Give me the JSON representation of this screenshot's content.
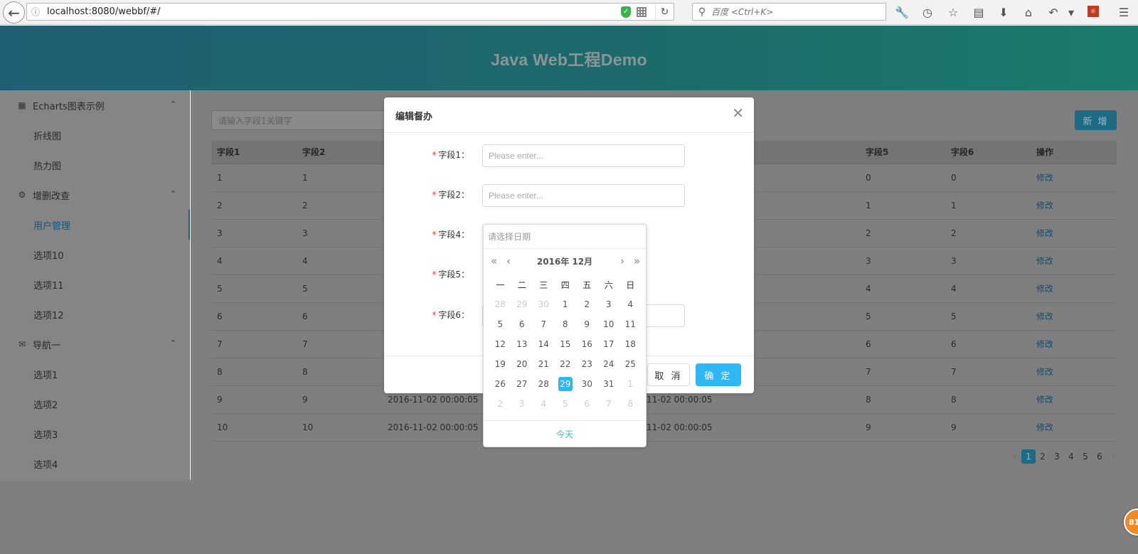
{
  "browser": {
    "url": "localhost:8080/webbf/#/",
    "search_placeholder": "百度 <Ctrl+K>"
  },
  "app": {
    "title": "Java Web工程Demo"
  },
  "sidebar": {
    "groups": [
      {
        "label": "Echarts图表示例",
        "items": [
          "折线图",
          "热力图"
        ]
      },
      {
        "label": "增删改查",
        "items": [
          "用户管理",
          "选项10",
          "选项11",
          "选项12"
        ]
      },
      {
        "label": "导航一",
        "items": [
          "选项1",
          "选项2",
          "选项3",
          "选项4"
        ]
      }
    ],
    "active_item": "用户管理"
  },
  "main": {
    "filter_placeholder": "请输入字段1关键字",
    "new_button": "新 增",
    "columns": [
      "字段1",
      "字段2",
      "",
      "",
      "",
      "",
      "",
      "字段5",
      "字段6",
      "操作"
    ],
    "rows": [
      [
        "1",
        "1",
        "",
        "",
        "0",
        "0",
        "修改"
      ],
      [
        "2",
        "2",
        "",
        "",
        "1",
        "1",
        "修改"
      ],
      [
        "3",
        "3",
        "",
        "",
        "2",
        "2",
        "修改"
      ],
      [
        "4",
        "4",
        "",
        "",
        "3",
        "3",
        "修改"
      ],
      [
        "5",
        "5",
        "",
        "",
        "4",
        "4",
        "修改"
      ],
      [
        "6",
        "6",
        "",
        "",
        "5",
        "5",
        "修改"
      ],
      [
        "7",
        "7",
        "",
        "",
        "6",
        "6",
        "修改"
      ],
      [
        "8",
        "8",
        "",
        "",
        "7",
        "7",
        "修改"
      ],
      [
        "9",
        "9",
        "2016-11-02 00:00:05",
        "6-11-02 00:00:05",
        "8",
        "8",
        "修改"
      ],
      [
        "10",
        "10",
        "2016-11-02 00:00:05",
        "6-11-02 00:00:05",
        "9",
        "9",
        "修改"
      ]
    ],
    "pagination": {
      "pages": [
        "1",
        "2",
        "3",
        "4",
        "5",
        "6"
      ],
      "current": "1",
      "prev": "‹",
      "next": "›"
    }
  },
  "modal": {
    "title": "编辑督办",
    "close": "✕",
    "fields": [
      {
        "label": "字段1",
        "placeholder": "Please enter..."
      },
      {
        "label": "字段2",
        "placeholder": "Please enter..."
      },
      {
        "label": "字段4"
      },
      {
        "label": "字段5"
      },
      {
        "label": "字段6"
      }
    ],
    "required_mark": "*",
    "cancel": "取 消",
    "ok": "确 定"
  },
  "datepicker": {
    "placeholder": "请选择日期",
    "header": "2016年 12月",
    "nav": {
      "prev_year": "«",
      "prev_month": "‹",
      "next_month": "›",
      "next_year": "»"
    },
    "weekdays": [
      "一",
      "二",
      "三",
      "四",
      "五",
      "六",
      "日"
    ],
    "days": [
      [
        "28",
        "m"
      ],
      [
        "29",
        "m"
      ],
      [
        "30",
        "m"
      ],
      [
        "1",
        ""
      ],
      [
        "2",
        ""
      ],
      [
        "3",
        ""
      ],
      [
        "4",
        ""
      ],
      [
        "5",
        ""
      ],
      [
        "6",
        ""
      ],
      [
        "7",
        ""
      ],
      [
        "8",
        ""
      ],
      [
        "9",
        ""
      ],
      [
        "10",
        ""
      ],
      [
        "11",
        ""
      ],
      [
        "12",
        ""
      ],
      [
        "13",
        ""
      ],
      [
        "14",
        ""
      ],
      [
        "15",
        ""
      ],
      [
        "16",
        ""
      ],
      [
        "17",
        ""
      ],
      [
        "18",
        ""
      ],
      [
        "19",
        ""
      ],
      [
        "20",
        ""
      ],
      [
        "21",
        ""
      ],
      [
        "22",
        ""
      ],
      [
        "23",
        ""
      ],
      [
        "24",
        ""
      ],
      [
        "25",
        ""
      ],
      [
        "26",
        ""
      ],
      [
        "27",
        ""
      ],
      [
        "28",
        ""
      ],
      [
        "29",
        "sel"
      ],
      [
        "30",
        ""
      ],
      [
        "31",
        ""
      ],
      [
        "1",
        "m"
      ],
      [
        "2",
        "m"
      ],
      [
        "3",
        "m"
      ],
      [
        "4",
        "m"
      ],
      [
        "5",
        "m"
      ],
      [
        "6",
        "m"
      ],
      [
        "7",
        "m"
      ],
      [
        "8",
        "m"
      ]
    ],
    "today": "今天"
  },
  "floating_badge": "81"
}
